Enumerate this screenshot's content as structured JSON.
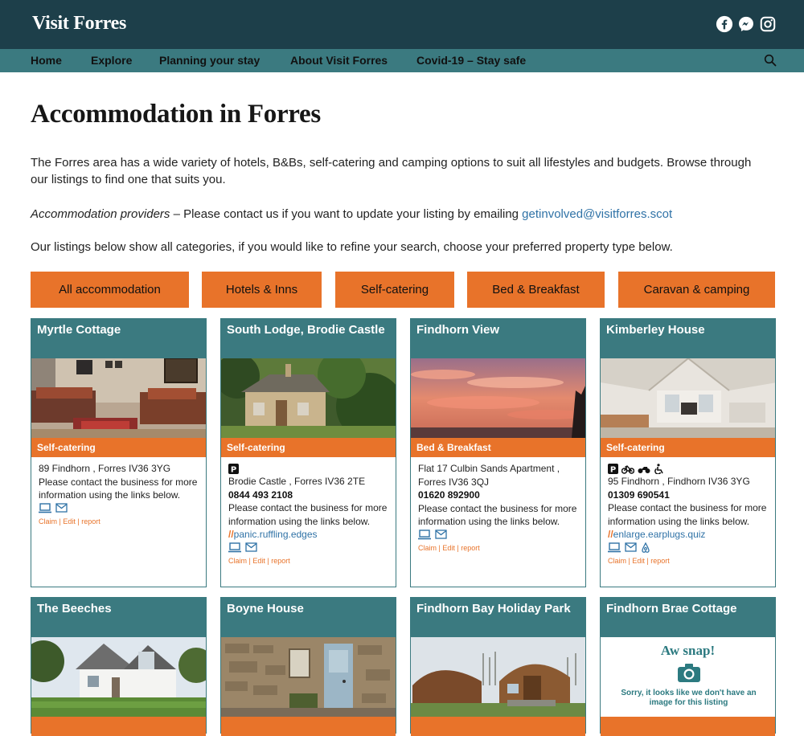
{
  "header": {
    "logo": "Visit Forres",
    "social_icons": [
      "facebook-icon",
      "messenger-icon",
      "instagram-icon"
    ]
  },
  "nav": {
    "items": [
      {
        "label": "Home"
      },
      {
        "label": "Explore"
      },
      {
        "label": "Planning your stay"
      },
      {
        "label": "About Visit Forres"
      },
      {
        "label": "Covid-19 – Stay safe"
      }
    ],
    "search_icon": "search-icon"
  },
  "page": {
    "title": "Accommodation in Forres",
    "intro": "The Forres area has a wide variety of hotels, B&Bs, self-catering and camping options to suit all lifestyles and budgets. Browse through our listings to find one that suits you.",
    "providers_em": "Accommodation providers",
    "providers_text": " – Please contact us if you want to update your listing by emailing ",
    "providers_email": "getinvolved@visitforres.scot",
    "refine_text": "Our listings below show all categories, if you would like to refine your search, choose your preferred property type below."
  },
  "filters": [
    {
      "label": "All accommodation"
    },
    {
      "label": "Hotels & Inns"
    },
    {
      "label": "Self-catering"
    },
    {
      "label": "Bed & Breakfast"
    },
    {
      "label": "Caravan & camping"
    }
  ],
  "listings": [
    {
      "title": "Myrtle Cottage",
      "category": "Self-catering",
      "address": "89 Findhorn , Forres IV36 3YG",
      "note": "Please contact the business for more information using the links below.",
      "meta": {
        "claim": "Claim",
        "edit": "Edit",
        "report": "report"
      }
    },
    {
      "title": "South Lodge, Brodie Castle",
      "category": "Self-catering",
      "address": "Brodie Castle , Forres IV36 2TE",
      "phone": "0844 493 2108",
      "note": "Please contact the business for more information using the links below.",
      "url": "panic.ruffling.edges",
      "meta": {
        "claim": "Claim",
        "edit": "Edit",
        "report": "report"
      }
    },
    {
      "title": "Findhorn View",
      "category": "Bed & Breakfast",
      "address": "Flat 17 Culbin Sands Apartment , Forres IV36 3QJ",
      "phone": "01620 892900",
      "note": "Please contact the business for more information using the links below.",
      "meta": {
        "claim": "Claim",
        "edit": "Edit",
        "report": "report"
      }
    },
    {
      "title": "Kimberley House",
      "category": "Self-catering",
      "address": "95 Findhorn , Findhorn IV36 3YG",
      "phone": "01309 690541",
      "note": "Please contact the business for more information using the links below.",
      "url": "enlarge.earplugs.quiz",
      "meta": {
        "claim": "Claim",
        "edit": "Edit",
        "report": "report"
      }
    },
    {
      "title": "The Beeches"
    },
    {
      "title": "Boyne House"
    },
    {
      "title": "Findhorn Bay Holiday Park"
    },
    {
      "title": "Findhorn Brae Cottage",
      "placeholder_title": "Aw snap!",
      "placeholder_text": "Sorry, it looks like we don't have an image for this listing"
    }
  ],
  "colors": {
    "header_bg": "#1d3f4a",
    "nav_bg": "#3b7a80",
    "accent_orange": "#e8732a",
    "link_blue": "#2f72a6"
  }
}
